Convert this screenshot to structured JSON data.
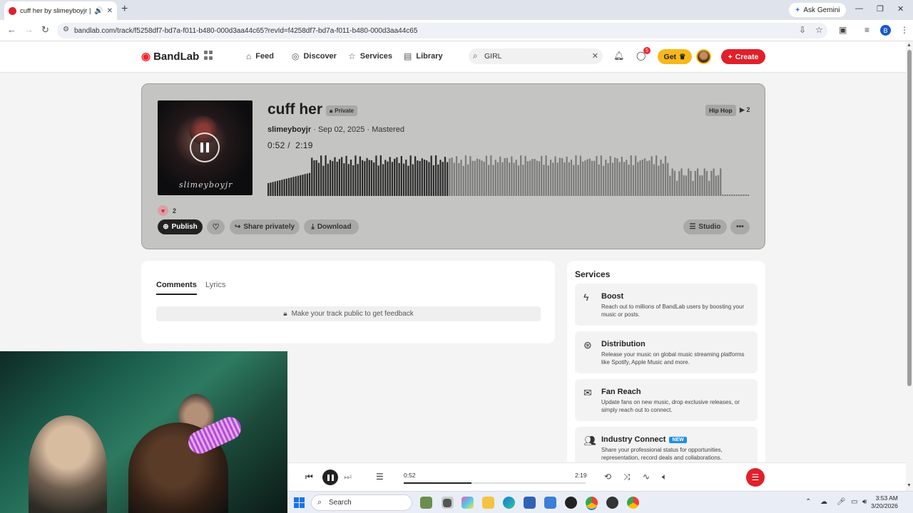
{
  "browser": {
    "tab_title": "cuff her by slimeyboyjr | Ba",
    "ask_gemini": "Ask Gemini",
    "url": "bandlab.com/track/f5258df7-bd7a-f011-b480-000d3aa44c65?revId=f4258df7-bd7a-f011-b480-000d3aa44c65",
    "profile_initial": "B"
  },
  "nav": {
    "brand": "BandLab",
    "links": [
      "Feed",
      "Discover",
      "Services",
      "Library"
    ],
    "search_value": "GIRL",
    "notification_count": "5",
    "get_label": "Get",
    "create_label": "Create"
  },
  "track": {
    "title": "cuff her",
    "privacy": "Private",
    "artist": "slimeyboyjr",
    "date": "Sep 02, 2025",
    "status": "Mastered",
    "time_current": "0:52",
    "time_total": "2:19",
    "genre": "Hip Hop",
    "plays": "2",
    "likes": "2",
    "cover_signature": "slimeyboyjr",
    "progress": 0.374,
    "actions": {
      "publish": "Publish",
      "share_privately": "Share privately",
      "download": "Download",
      "studio": "Studio"
    }
  },
  "comments": {
    "tabs": [
      "Comments",
      "Lyrics"
    ],
    "notice": "Make your track public to get feedback"
  },
  "services": {
    "heading": "Services",
    "items": [
      {
        "name": "Boost",
        "desc": "Reach out to millions of BandLab users by boosting your music or posts.",
        "icon": "lightning-icon"
      },
      {
        "name": "Distribution",
        "desc": "Release your music on global music streaming platforms like Spotify, Apple Music and more.",
        "icon": "distribution-icon"
      },
      {
        "name": "Fan Reach",
        "desc": "Update fans on new music, drop exclusive releases, or simply reach out to connect.",
        "icon": "envelope-icon"
      },
      {
        "name": "Industry Connect",
        "tag": "NEW",
        "desc": "Share your professional status for opportunities, representation, record deals and collaborations.",
        "icon": "people-icon"
      }
    ]
  },
  "player": {
    "current": "0:52",
    "total": "2:19",
    "progress": 0.374
  },
  "taskbar": {
    "search_label": "Search",
    "time": "3:53 AM",
    "date": "3/20/2026"
  },
  "colors": {
    "accent_red": "#e0202b",
    "get_yellow": "#f8b81b",
    "card_gray": "#c4c4c2"
  }
}
